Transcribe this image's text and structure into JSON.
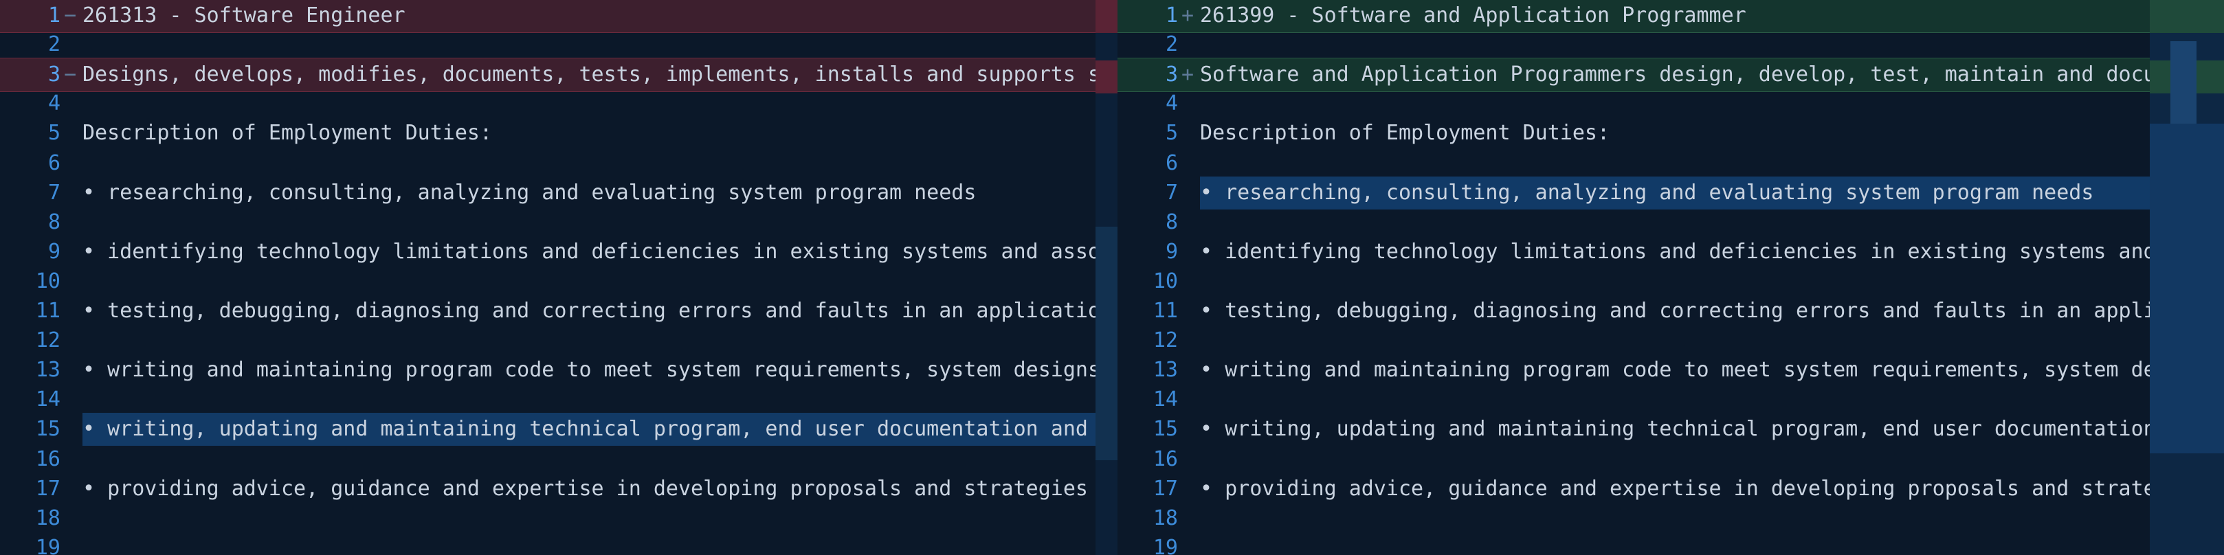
{
  "left": {
    "lines": [
      {
        "n": "1",
        "marker": "−",
        "type": "removed",
        "text": "261313 - Software Engineer",
        "marks": [
          "261313",
          "Engineer"
        ]
      },
      {
        "n": "2",
        "marker": "",
        "type": "normal",
        "text": ""
      },
      {
        "n": "3",
        "marker": "−",
        "type": "removed",
        "text": "Designs, develops, modifies, documents, tests, implements, installs and supports software",
        "marks": [
          "s",
          "s",
          "s",
          "s",
          "s",
          "s",
          "installs",
          "supports software"
        ]
      },
      {
        "n": "4",
        "marker": "",
        "type": "normal",
        "text": ""
      },
      {
        "n": "5",
        "marker": "",
        "type": "normal",
        "text": "Description of Employment Duties:"
      },
      {
        "n": "6",
        "marker": "",
        "type": "normal",
        "text": ""
      },
      {
        "n": "7",
        "marker": "",
        "type": "normal",
        "text": "• researching, consulting, analyzing and evaluating system program needs"
      },
      {
        "n": "8",
        "marker": "",
        "type": "normal",
        "text": ""
      },
      {
        "n": "9",
        "marker": "",
        "type": "normal",
        "text": "• identifying technology limitations and deficiencies in existing systems and associated"
      },
      {
        "n": "10",
        "marker": "",
        "type": "normal",
        "text": ""
      },
      {
        "n": "11",
        "marker": "",
        "type": "normal",
        "text": "• testing, debugging, diagnosing and correcting errors and faults in an applications programming"
      },
      {
        "n": "12",
        "marker": "",
        "type": "normal",
        "text": ""
      },
      {
        "n": "13",
        "marker": "",
        "type": "normal",
        "text": "• writing and maintaining program code to meet system requirements, system designs and technical"
      },
      {
        "n": "14",
        "marker": "",
        "type": "normal",
        "text": ""
      },
      {
        "n": "15",
        "marker": "",
        "type": "selected",
        "text": "• writing, updating and maintaining technical program, end user documentation and operational"
      },
      {
        "n": "16",
        "marker": "",
        "type": "normal",
        "text": ""
      },
      {
        "n": "17",
        "marker": "",
        "type": "normal",
        "text": "• providing advice, guidance and expertise in developing proposals and strategies for software"
      },
      {
        "n": "18",
        "marker": "",
        "type": "normal",
        "text": ""
      },
      {
        "n": "19",
        "marker": "",
        "type": "normal",
        "text": ""
      }
    ]
  },
  "right": {
    "lines": [
      {
        "n": "1",
        "marker": "+",
        "type": "added",
        "text": "261399 - Software and Application Programmer"
      },
      {
        "n": "2",
        "marker": "",
        "type": "normal",
        "text": ""
      },
      {
        "n": "3",
        "marker": "+",
        "type": "added",
        "text": "Software and Application Programmers design, develop, test, maintain and document program"
      },
      {
        "n": "4",
        "marker": "",
        "type": "normal",
        "text": ""
      },
      {
        "n": "5",
        "marker": "",
        "type": "normal",
        "text": "Description of Employment Duties:"
      },
      {
        "n": "6",
        "marker": "",
        "type": "normal",
        "text": ""
      },
      {
        "n": "7",
        "marker": "",
        "type": "selected",
        "text": "• researching, consulting, analyzing and evaluating system program needs"
      },
      {
        "n": "8",
        "marker": "",
        "type": "normal",
        "text": ""
      },
      {
        "n": "9",
        "marker": "",
        "type": "normal",
        "text": "• identifying technology limitations and deficiencies in existing systems and associated"
      },
      {
        "n": "10",
        "marker": "",
        "type": "normal",
        "text": ""
      },
      {
        "n": "11",
        "marker": "",
        "type": "normal",
        "text": "• testing, debugging, diagnosing and correcting errors and faults in an applications programming"
      },
      {
        "n": "12",
        "marker": "",
        "type": "normal",
        "text": ""
      },
      {
        "n": "13",
        "marker": "",
        "type": "normal",
        "text": "• writing and maintaining program code to meet system requirements, system designs and technical"
      },
      {
        "n": "14",
        "marker": "",
        "type": "normal",
        "text": ""
      },
      {
        "n": "15",
        "marker": "",
        "type": "normal",
        "text": "• writing, updating and maintaining technical program, end user documentation and operational"
      },
      {
        "n": "16",
        "marker": "",
        "type": "normal",
        "text": ""
      },
      {
        "n": "17",
        "marker": "",
        "type": "normal",
        "text": "• providing advice, guidance and expertise in developing proposals and strategies for software"
      },
      {
        "n": "18",
        "marker": "",
        "type": "normal",
        "text": ""
      },
      {
        "n": "19",
        "marker": "",
        "type": "normal",
        "text": ""
      }
    ]
  },
  "colors": {
    "background": "#0b1829",
    "removed_line": "#3d1f2e",
    "removed_word": "#6b2236",
    "added_line": "#14352e",
    "added_word": "#25553f",
    "selection": "#123a66",
    "line_number": "#3d8bd9",
    "text": "#c9d3e0"
  }
}
